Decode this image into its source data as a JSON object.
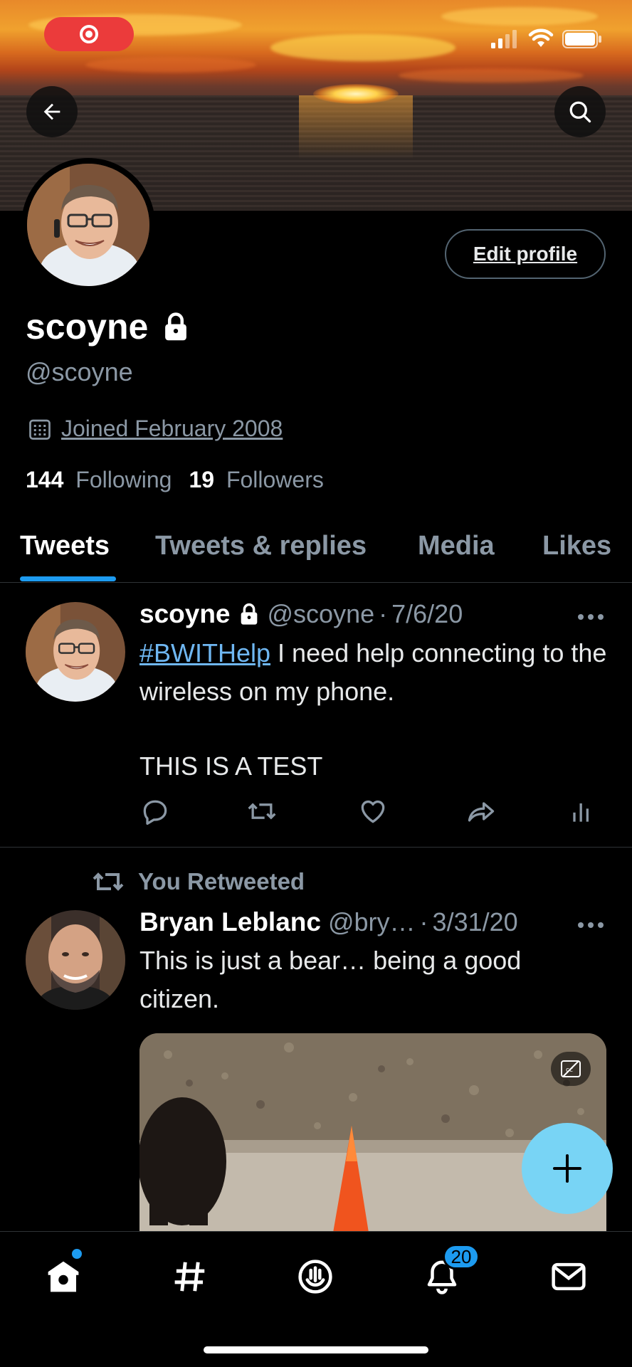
{
  "profile": {
    "display_name": "scoyne",
    "handle": "@scoyne",
    "joined": "Joined February 2008",
    "following_count": "144",
    "following_label": "Following",
    "followers_count": "19",
    "followers_label": "Followers",
    "edit_profile_label": "Edit profile"
  },
  "tabs": [
    {
      "label": "Tweets",
      "active": true
    },
    {
      "label": "Tweets & replies",
      "active": false
    },
    {
      "label": "Media",
      "active": false
    },
    {
      "label": "Likes",
      "active": false
    }
  ],
  "tweets": [
    {
      "name": "scoyne",
      "handle": "@scoyne",
      "separator": "·",
      "date": "7/6/20",
      "hashtag": "#BWITHelp",
      "text_after_hashtag": " I need help connecting to the wireless on my phone.",
      "text_line2": "THIS IS A TEST"
    },
    {
      "context": "You Retweeted",
      "name": "Bryan Leblanc",
      "handle": "@bry…",
      "separator": "·",
      "date": "3/31/20",
      "text": "This is just a bear… being a good citizen."
    }
  ],
  "nav": {
    "notifications_badge": "20"
  },
  "icons": {
    "recording": "record-icon",
    "back": "arrow-left-icon",
    "search": "search-icon",
    "lock": "lock-icon",
    "calendar": "calendar-icon",
    "more": "more-dots-icon",
    "reply": "reply-icon",
    "retweet": "retweet-icon",
    "like": "heart-icon",
    "share": "share-icon",
    "analytics": "analytics-icon",
    "captions": "captions-icon",
    "compose": "plus-icon",
    "home": "home-icon",
    "explore": "hashtag-icon",
    "spaces": "spaces-icon",
    "notifications": "bell-icon",
    "messages": "envelope-icon"
  },
  "colors": {
    "accent": "#1d9bf0",
    "fab": "#78d4f5",
    "record_pill": "#eb3b3b",
    "hashtag": "#6fb7f2",
    "secondary_text": "#8b98a5"
  }
}
